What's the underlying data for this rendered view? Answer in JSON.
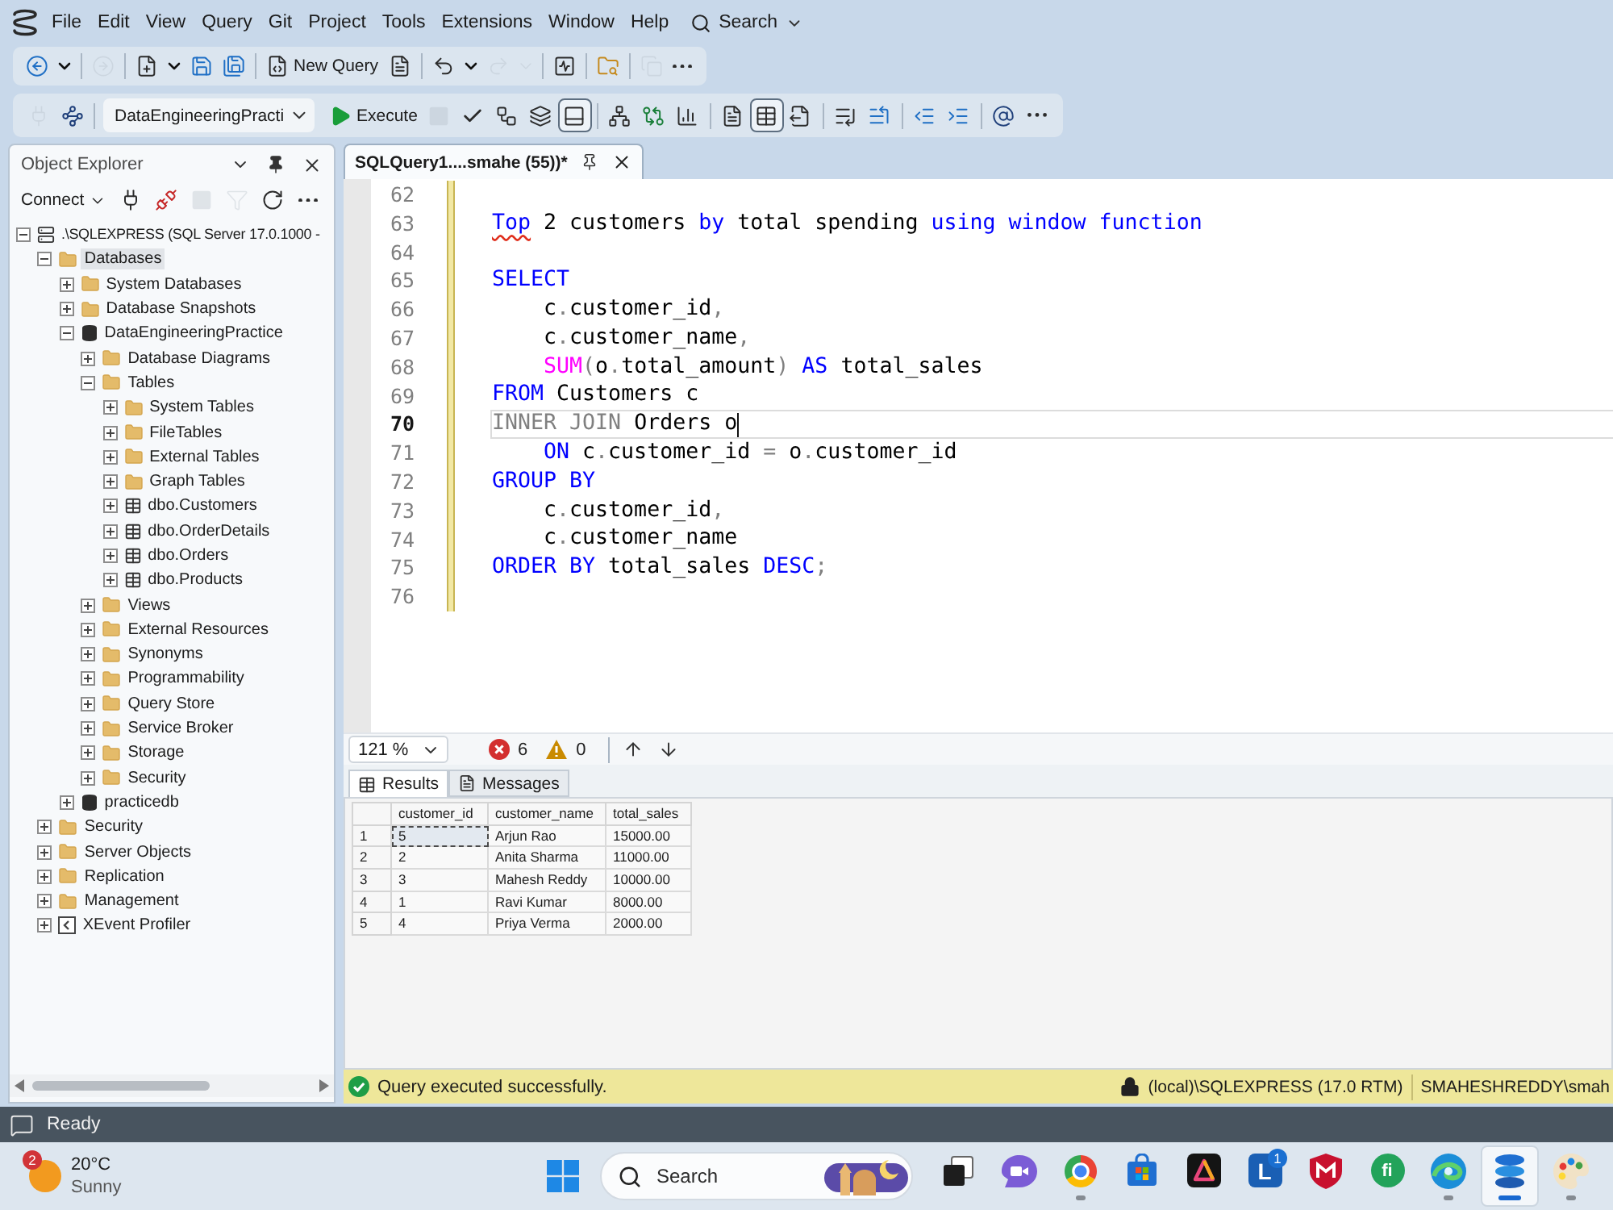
{
  "menu_bar": {
    "items": [
      "File",
      "Edit",
      "View",
      "Query",
      "Git",
      "Project",
      "Tools",
      "Extensions",
      "Window",
      "Help"
    ],
    "search": "Search"
  },
  "standard_toolbar": {
    "groups": [
      [
        {
          "kind": "back",
          "disabled": false
        },
        {
          "kind": "caret",
          "disabled": false
        }
      ],
      [
        {
          "kind": "forward",
          "disabled": true
        }
      ],
      [
        {
          "kind": "newfile",
          "disabled": false
        },
        {
          "kind": "caret",
          "disabled": false
        },
        {
          "kind": "save",
          "disabled": false
        },
        {
          "kind": "saveall",
          "disabled": false
        }
      ],
      [
        {
          "kind": "newquery",
          "label": "New Query",
          "disabled": false
        },
        {
          "kind": "openfile",
          "disabled": false
        }
      ],
      [
        {
          "kind": "undo",
          "disabled": false
        },
        {
          "kind": "caret",
          "disabled": false
        },
        {
          "kind": "redo",
          "disabled": true
        },
        {
          "kind": "caret",
          "disabled": true
        }
      ],
      [
        {
          "kind": "monitor",
          "disabled": false
        }
      ],
      [
        {
          "kind": "browse",
          "disabled": false
        }
      ],
      [
        {
          "kind": "windows",
          "disabled": true
        },
        {
          "kind": "more",
          "disabled": false
        }
      ]
    ]
  },
  "sql_toolbar": {
    "groups": [
      [
        {
          "kind": "plug",
          "disabled": true,
          "pressed": false
        },
        {
          "kind": "connection",
          "disabled": false,
          "pressed": false
        }
      ],
      [
        {
          "kind": "database",
          "value": "DataEngineeringPracti",
          "disabled": false
        },
        {
          "kind": "execute",
          "label": "Execute",
          "disabled": false,
          "pressed": false
        },
        {
          "kind": "stop",
          "disabled": true,
          "pressed": false
        },
        {
          "kind": "parse",
          "disabled": false,
          "pressed": false
        },
        {
          "kind": "plan",
          "disabled": false,
          "pressed": false
        },
        {
          "kind": "options",
          "disabled": false,
          "pressed": false
        },
        {
          "kind": "panel",
          "disabled": false,
          "pressed": true
        }
      ],
      [
        {
          "kind": "liveplan",
          "disabled": false,
          "pressed": false
        },
        {
          "kind": "clientstats",
          "disabled": false,
          "pressed": false
        },
        {
          "kind": "stats",
          "disabled": false,
          "pressed": false
        }
      ],
      [
        {
          "kind": "text",
          "disabled": false,
          "pressed": false
        },
        {
          "kind": "grid",
          "disabled": false,
          "pressed": true
        },
        {
          "kind": "file",
          "disabled": false,
          "pressed": false
        }
      ],
      [
        {
          "kind": "comment",
          "disabled": false,
          "pressed": false
        },
        {
          "kind": "uncomment",
          "disabled": false,
          "pressed": false
        }
      ],
      [
        {
          "kind": "outdent",
          "disabled": false,
          "pressed": false
        },
        {
          "kind": "indent",
          "disabled": false,
          "pressed": false
        }
      ],
      [
        {
          "kind": "parameters",
          "disabled": false,
          "pressed": false
        },
        {
          "kind": "more",
          "disabled": false,
          "pressed": false
        }
      ]
    ]
  },
  "object_explorer": {
    "title": "Object Explorer",
    "toolbar": [
      {
        "kind": "connect",
        "label": "Connect",
        "disabled": false
      },
      {
        "kind": "plug",
        "disabled": false
      },
      {
        "kind": "disconnect",
        "disabled": false
      },
      {
        "kind": "stop",
        "disabled": true
      },
      {
        "kind": "filter",
        "disabled": true
      },
      {
        "kind": "refresh",
        "disabled": false
      },
      {
        "kind": "more",
        "disabled": false
      }
    ],
    "tree": [
      {
        "label": ".\\SQLEXPRESS (SQL Server 17.0.1000 -",
        "kind": "server",
        "expanded": true,
        "selected": false,
        "children": [
          {
            "label": "Databases",
            "kind": "folder",
            "expanded": true,
            "selected": true,
            "children": [
              {
                "label": "System Databases",
                "kind": "folder",
                "expanded": false,
                "selected": false
              },
              {
                "label": "Database Snapshots",
                "kind": "folder",
                "expanded": false,
                "selected": false
              },
              {
                "label": "DataEngineeringPractice",
                "kind": "database",
                "expanded": true,
                "selected": false,
                "children": [
                  {
                    "label": "Database Diagrams",
                    "kind": "folder",
                    "expanded": false,
                    "selected": false
                  },
                  {
                    "label": "Tables",
                    "kind": "folder",
                    "expanded": true,
                    "selected": false,
                    "children": [
                      {
                        "label": "System Tables",
                        "kind": "folder",
                        "expanded": false,
                        "selected": false
                      },
                      {
                        "label": "FileTables",
                        "kind": "folder",
                        "expanded": false,
                        "selected": false
                      },
                      {
                        "label": "External Tables",
                        "kind": "folder",
                        "expanded": false,
                        "selected": false
                      },
                      {
                        "label": "Graph Tables",
                        "kind": "folder",
                        "expanded": false,
                        "selected": false
                      },
                      {
                        "label": "dbo.Customers",
                        "kind": "table",
                        "expanded": false,
                        "selected": false
                      },
                      {
                        "label": "dbo.OrderDetails",
                        "kind": "table",
                        "expanded": false,
                        "selected": false
                      },
                      {
                        "label": "dbo.Orders",
                        "kind": "table",
                        "expanded": false,
                        "selected": false
                      },
                      {
                        "label": "dbo.Products",
                        "kind": "table",
                        "expanded": false,
                        "selected": false
                      }
                    ]
                  },
                  {
                    "label": "Views",
                    "kind": "folder",
                    "expanded": false,
                    "selected": false
                  },
                  {
                    "label": "External Resources",
                    "kind": "folder",
                    "expanded": false,
                    "selected": false
                  },
                  {
                    "label": "Synonyms",
                    "kind": "folder",
                    "expanded": false,
                    "selected": false
                  },
                  {
                    "label": "Programmability",
                    "kind": "folder",
                    "expanded": false,
                    "selected": false
                  },
                  {
                    "label": "Query Store",
                    "kind": "folder",
                    "expanded": false,
                    "selected": false
                  },
                  {
                    "label": "Service Broker",
                    "kind": "folder",
                    "expanded": false,
                    "selected": false
                  },
                  {
                    "label": "Storage",
                    "kind": "folder",
                    "expanded": false,
                    "selected": false
                  },
                  {
                    "label": "Security",
                    "kind": "folder",
                    "expanded": false,
                    "selected": false
                  }
                ]
              },
              {
                "label": "practicedb",
                "kind": "database",
                "expanded": false,
                "selected": false
              }
            ]
          },
          {
            "label": "Security",
            "kind": "folder",
            "expanded": false,
            "selected": false
          },
          {
            "label": "Server Objects",
            "kind": "folder",
            "expanded": false,
            "selected": false
          },
          {
            "label": "Replication",
            "kind": "folder",
            "expanded": false,
            "selected": false
          },
          {
            "label": "Management",
            "kind": "folder",
            "expanded": false,
            "selected": false
          },
          {
            "label": "XEvent Profiler",
            "kind": "profiler",
            "expanded": false,
            "selected": false
          }
        ]
      }
    ]
  },
  "editor": {
    "tab": {
      "title": "SQLQuery1....smahe (55))*",
      "selected": true
    },
    "lines": [
      {
        "number": "62",
        "modified": true,
        "selected": false
      },
      {
        "number": "63",
        "modified": true,
        "selected": false,
        "indented": false,
        "tokens": [
          {
            "kind": "flagged",
            "text": "Top"
          },
          {
            "kind": "plain",
            "text": " 2 customers "
          },
          {
            "kind": "keyword",
            "text": "by"
          },
          {
            "kind": "plain",
            "text": " total spending "
          },
          {
            "kind": "keyword",
            "text": "using window function"
          }
        ]
      },
      {
        "number": "64",
        "modified": true,
        "selected": false
      },
      {
        "number": "65",
        "modified": true,
        "selected": false,
        "indented": false,
        "tokens": [
          {
            "kind": "keyword",
            "text": "SELECT"
          }
        ]
      },
      {
        "number": "66",
        "modified": true,
        "selected": false,
        "indented": true,
        "tokens": [
          {
            "kind": "plain",
            "text": "c"
          },
          {
            "kind": "punct",
            "text": "."
          },
          {
            "kind": "plain",
            "text": "customer_id"
          },
          {
            "kind": "punct",
            "text": ","
          }
        ]
      },
      {
        "number": "67",
        "modified": true,
        "selected": false,
        "indented": true,
        "tokens": [
          {
            "kind": "plain",
            "text": "c"
          },
          {
            "kind": "punct",
            "text": "."
          },
          {
            "kind": "plain",
            "text": "customer_name"
          },
          {
            "kind": "punct",
            "text": ","
          }
        ]
      },
      {
        "number": "68",
        "modified": true,
        "selected": false,
        "indented": true,
        "tokens": [
          {
            "kind": "function",
            "text": "SUM"
          },
          {
            "kind": "punct",
            "text": "("
          },
          {
            "kind": "plain",
            "text": "o"
          },
          {
            "kind": "punct",
            "text": "."
          },
          {
            "kind": "plain",
            "text": "total_amount"
          },
          {
            "kind": "punct",
            "text": ")"
          },
          {
            "kind": "keyword",
            "text": " AS"
          },
          {
            "kind": "plain",
            "text": " total_sales"
          }
        ]
      },
      {
        "number": "69",
        "modified": true,
        "selected": false,
        "indented": false,
        "tokens": [
          {
            "kind": "keyword",
            "text": "FROM"
          },
          {
            "kind": "plain",
            "text": " Customers c"
          }
        ]
      },
      {
        "number": "70",
        "modified": true,
        "selected": true,
        "indented": false,
        "tokens": [
          {
            "kind": "dim",
            "text": "INNER JOIN"
          },
          {
            "kind": "plain",
            "text": " Orders o"
          }
        ]
      },
      {
        "number": "71",
        "modified": true,
        "selected": false,
        "indented": true,
        "tokens": [
          {
            "kind": "keyword",
            "text": "ON"
          },
          {
            "kind": "plain",
            "text": " c"
          },
          {
            "kind": "punct",
            "text": "."
          },
          {
            "kind": "plain",
            "text": "customer_id "
          },
          {
            "kind": "punct",
            "text": "="
          },
          {
            "kind": "plain",
            "text": " o"
          },
          {
            "kind": "punct",
            "text": "."
          },
          {
            "kind": "plain",
            "text": "customer_id"
          }
        ]
      },
      {
        "number": "72",
        "modified": true,
        "selected": false,
        "indented": false,
        "tokens": [
          {
            "kind": "keyword",
            "text": "GROUP BY"
          }
        ]
      },
      {
        "number": "73",
        "modified": true,
        "selected": false,
        "indented": true,
        "tokens": [
          {
            "kind": "plain",
            "text": "c"
          },
          {
            "kind": "punct",
            "text": "."
          },
          {
            "kind": "plain",
            "text": "customer_id"
          },
          {
            "kind": "punct",
            "text": ","
          }
        ]
      },
      {
        "number": "74",
        "modified": true,
        "selected": false,
        "indented": true,
        "tokens": [
          {
            "kind": "plain",
            "text": "c"
          },
          {
            "kind": "punct",
            "text": "."
          },
          {
            "kind": "plain",
            "text": "customer_name"
          }
        ]
      },
      {
        "number": "75",
        "modified": true,
        "selected": false,
        "indented": false,
        "tokens": [
          {
            "kind": "keyword",
            "text": "ORDER BY"
          },
          {
            "kind": "plain",
            "text": " total_sales "
          },
          {
            "kind": "keyword",
            "text": "DESC"
          },
          {
            "kind": "punct",
            "text": ";"
          }
        ]
      },
      {
        "number": "76",
        "modified": true,
        "selected": false
      }
    ],
    "footer": {
      "zoom": "121 %",
      "errors": "6",
      "warnings": "0"
    }
  },
  "results": {
    "tabs": [
      {
        "kind": "grid",
        "label": "Results",
        "selected": true
      },
      {
        "kind": "messages",
        "label": "Messages",
        "selected": false
      }
    ],
    "columns": [
      "customer_id",
      "customer_name",
      "total_sales"
    ],
    "rows": [
      {
        "number": "1",
        "cells": [
          "5",
          "Arjun Rao",
          "15000.00"
        ],
        "focused": true
      },
      {
        "number": "2",
        "cells": [
          "2",
          "Anita Sharma",
          "11000.00"
        ],
        "focused": false
      },
      {
        "number": "3",
        "cells": [
          "3",
          "Mahesh Reddy",
          "10000.00"
        ],
        "focused": false
      },
      {
        "number": "4",
        "cells": [
          "1",
          "Ravi Kumar",
          "8000.00"
        ],
        "focused": false
      },
      {
        "number": "5",
        "cells": [
          "4",
          "Priya Verma",
          "2000.00"
        ],
        "focused": false
      }
    ]
  },
  "query_status": {
    "message": "Query executed successfully.",
    "server": "(local)\\SQLEXPRESS (17.0 RTM)",
    "login": "SMAHESHREDDY\\smah"
  },
  "app_status": {
    "text": "Ready"
  },
  "taskbar": {
    "weather": {
      "badge": "2",
      "temperature": "20°C",
      "condition": "Sunny"
    },
    "search": {
      "placeholder": "Search"
    },
    "apps": [
      {
        "kind": "taskview",
        "running": false,
        "selected": false
      },
      {
        "kind": "meet",
        "running": false,
        "selected": false
      },
      {
        "kind": "browser",
        "running": true,
        "selected": false
      },
      {
        "kind": "store",
        "running": false,
        "selected": false
      },
      {
        "kind": "design",
        "running": false,
        "selected": false
      },
      {
        "kind": "letter",
        "glyph": "L",
        "badge": "1",
        "running": false,
        "selected": false
      },
      {
        "kind": "shield",
        "running": false,
        "selected": false
      },
      {
        "kind": "finance",
        "glyph": "fi",
        "running": false,
        "selected": false
      },
      {
        "kind": "wave",
        "running": true,
        "selected": false
      },
      {
        "kind": "database",
        "running": true,
        "selected": true
      },
      {
        "kind": "paint",
        "running": true,
        "selected": false
      }
    ]
  }
}
